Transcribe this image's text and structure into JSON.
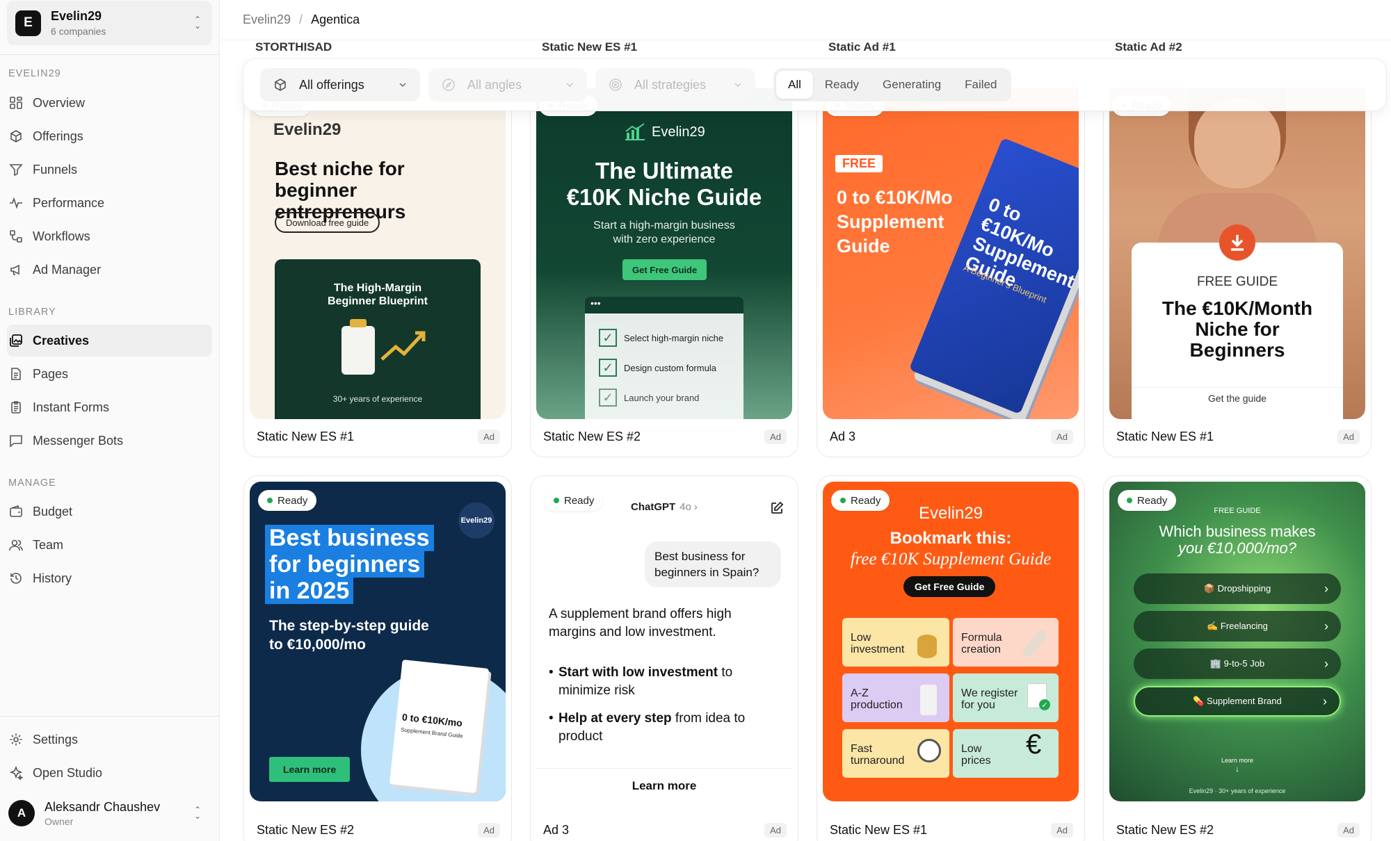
{
  "company": {
    "initial": "E",
    "name": "Evelin29",
    "subtitle": "6 companies"
  },
  "sections": {
    "workspace": "EVELIN29",
    "library": "LIBRARY",
    "manage": "MANAGE"
  },
  "nav": {
    "overview": "Overview",
    "offerings": "Offerings",
    "funnels": "Funnels",
    "performance": "Performance",
    "workflows": "Workflows",
    "ad_manager": "Ad Manager",
    "creatives": "Creatives",
    "pages": "Pages",
    "instant_forms": "Instant Forms",
    "messenger_bots": "Messenger Bots",
    "budget": "Budget",
    "team": "Team",
    "history": "History",
    "settings": "Settings",
    "open_studio": "Open Studio"
  },
  "user": {
    "initial": "A",
    "name": "Aleksandr Chaushev",
    "role": "Owner"
  },
  "breadcrumb": {
    "company": "Evelin29",
    "separator": "/",
    "current": "Agentica"
  },
  "peek_titles": [
    "STORTHISAD",
    "Static New ES #1",
    "Static Ad #1",
    "Static Ad #2"
  ],
  "filters": {
    "offerings": "All offerings",
    "angles": "All angles",
    "strategies": "All strategies",
    "status_tabs": [
      "All",
      "Ready",
      "Generating",
      "Failed"
    ],
    "active_status": "All"
  },
  "ad_tag": "Ad",
  "ready_label": "Ready",
  "cards": [
    {
      "title": "Static New ES #1",
      "ad": {
        "brand": "Evelin29",
        "headline": "Best niche for beginner entrepreneurs",
        "button": "Download free guide",
        "panel_title": "The High-Margin Beginner Blueprint",
        "panel_footer": "30+ years of experience"
      }
    },
    {
      "title": "Static New ES #2",
      "ad": {
        "brand": "Evelin29",
        "headline1": "The Ultimate",
        "headline2": "€10K Niche Guide",
        "sub1": "Start a high-margin business",
        "sub2": "with zero experience",
        "button": "Get Free Guide",
        "checks": [
          "Select high-margin niche",
          "Design custom formula",
          "Launch your brand"
        ]
      }
    },
    {
      "title": "Ad 3",
      "ad": {
        "badge": "FREE",
        "headline1": "0 to €10K/Mo",
        "headline2": "Supplement",
        "headline3": "Guide",
        "book1": "0 to €10K/Mo",
        "book2": "Supplement",
        "book3": "Guide",
        "book_sub": "A Beginner's Blueprint"
      }
    },
    {
      "title": "Static New ES #1",
      "ad": {
        "label": "FREE GUIDE",
        "headline1": "The €10K/Month",
        "headline2": "Niche for",
        "headline3": "Beginners",
        "cta": "Get the guide"
      }
    },
    {
      "title": "Static New ES #2",
      "ad": {
        "brand": "Evelin29",
        "headline1": "Best business",
        "headline2": "for beginners",
        "headline3": "in 2025",
        "sub1": "The step-by-step guide",
        "sub2": "to €10,000/mo",
        "book1": "0 to €10K/mo",
        "book2": "Supplement Brand Guide",
        "button": "Learn more"
      }
    },
    {
      "title": "Ad 3",
      "ad": {
        "app": "ChatGPT",
        "model": "4o",
        "question1": "Best business for",
        "question2": "beginners in Spain?",
        "answer": "A supplement brand offers high margins and low investment.",
        "b1_bold": "Start with low investment",
        "b1_rest": " to minimize risk",
        "b2_bold": "Help at every step",
        "b2_rest": " from idea to product",
        "button": "Learn more"
      }
    },
    {
      "title": "Static New ES #1",
      "ad": {
        "brand": "Evelin29",
        "headline": "Bookmark this:",
        "subheadline": "free €10K Supplement Guide",
        "button": "Get Free Guide",
        "tiles": [
          {
            "l1": "Low",
            "l2": "investment",
            "bg": "#fbe6a6"
          },
          {
            "l1": "Formula",
            "l2": "creation",
            "bg": "#fdd8c8"
          },
          {
            "l1": "A-Z",
            "l2": "production",
            "bg": "#dccbf3"
          },
          {
            "l1": "We register",
            "l2": "for you",
            "bg": "#c8ebd9"
          },
          {
            "l1": "Fast",
            "l2": "turnaround",
            "bg": "#fbe6a6"
          },
          {
            "l1": "Low",
            "l2": "prices",
            "bg": "#c8ebd9"
          }
        ]
      }
    },
    {
      "title": "Static New ES #2",
      "ad": {
        "label": "FREE GUIDE",
        "q1": "Which business makes",
        "q2": "you €10,000/mo?",
        "options": [
          "📦 Dropshipping",
          "✍️ Freelancing",
          "🏢 9-to-5 Job",
          "💊 Supplement Brand"
        ],
        "learn": "Learn more",
        "footer": "Evelin29 · 30+ years of experience"
      }
    }
  ]
}
